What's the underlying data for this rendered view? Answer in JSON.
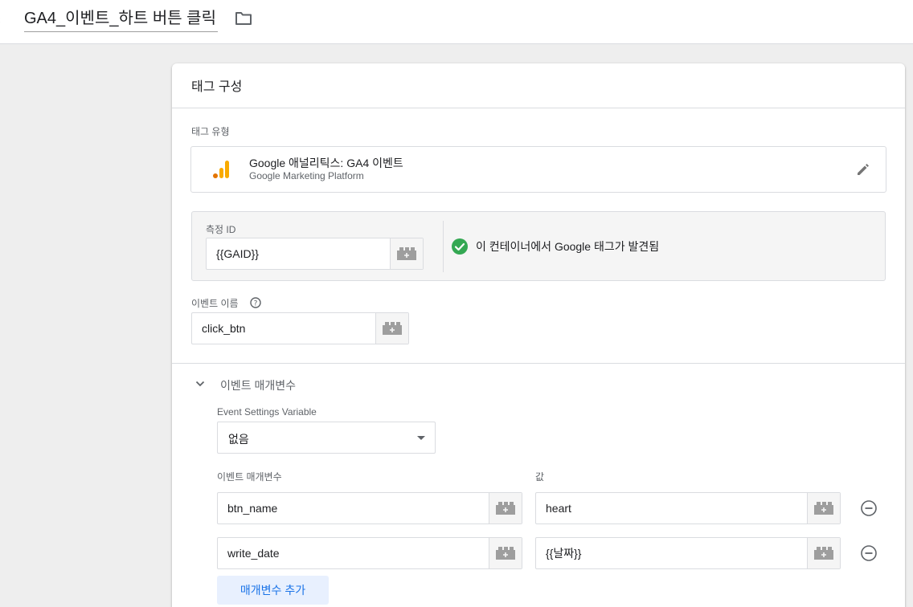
{
  "header": {
    "back_glyph": "‹",
    "tag_name": "GA4_이벤트_하트 버튼 클릭"
  },
  "card": {
    "title": "태그 구성",
    "tag_type": {
      "label": "태그 유형",
      "name": "Google 애널리틱스: GA4 이벤트",
      "platform": "Google Marketing Platform"
    },
    "measurement": {
      "label": "측정 ID",
      "value": "{{GAID}}",
      "status_text": "이 컨테이너에서 Google 태그가 발견됨"
    },
    "event_name": {
      "label": "이벤트 이름",
      "value": "click_btn"
    },
    "event_params": {
      "section_title": "이벤트 매개변수",
      "settings_variable_label": "Event Settings Variable",
      "settings_variable_value": "없음",
      "param_header": "이벤트 매개변수",
      "value_header": "값",
      "rows": [
        {
          "param": "btn_name",
          "value": "heart"
        },
        {
          "param": "write_date",
          "value": "{{날짜}}"
        }
      ],
      "add_button": "매개변수 추가"
    }
  },
  "colors": {
    "accent": "#1a73e8",
    "success": "#34a853",
    "ga_orange": "#f9ab00",
    "ga_dark_orange": "#e37400"
  }
}
